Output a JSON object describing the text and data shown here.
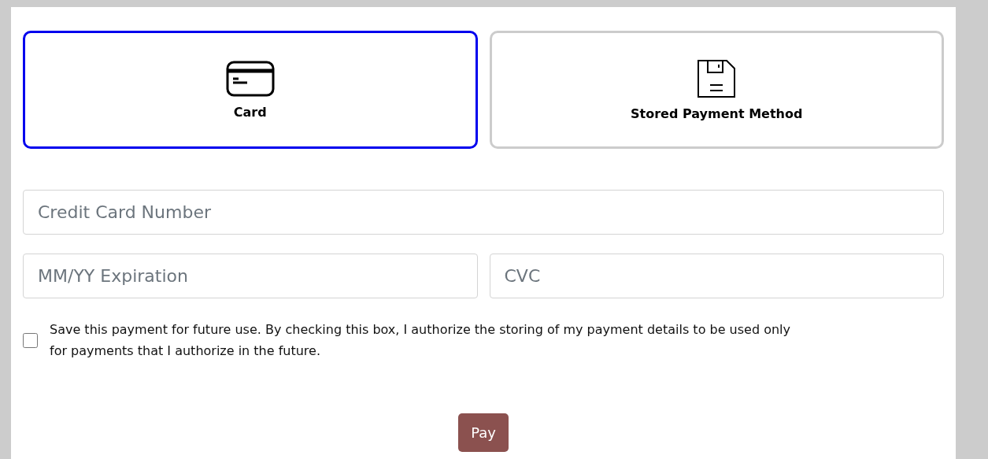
{
  "payment_methods": [
    {
      "kind": "card",
      "label": "Card",
      "selected": true
    },
    {
      "kind": "stored",
      "label": "Stored Payment Method",
      "selected": false
    }
  ],
  "card_number": {
    "placeholder": "Credit Card Number"
  },
  "expiration": {
    "placeholder": "MM/YY Expiration"
  },
  "cvc": {
    "placeholder": "CVC"
  },
  "save_payment": {
    "checked": false,
    "label": "Save this payment for future use. By checking this box, I authorize the storing of my payment details to be used only for payments that I authorize in the future."
  },
  "pay_button": "Pay"
}
